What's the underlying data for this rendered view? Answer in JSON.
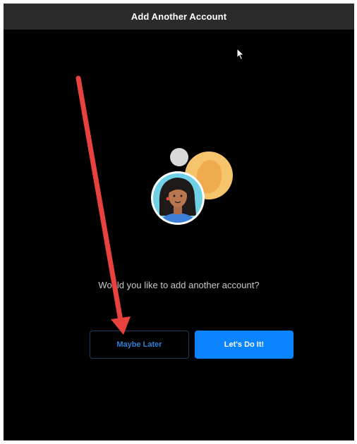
{
  "window": {
    "title": "Add Another Account"
  },
  "dialog": {
    "question": "Would you like to add another account?",
    "maybe_later_label": "Maybe Later",
    "lets_do_it_label": "Let's Do It!"
  },
  "colors": {
    "titlebar_bg": "#2b2b2b",
    "background": "#000000",
    "primary_button": "#0a84ff",
    "secondary_button_text": "#2f7fd6",
    "annotation_arrow": "#e8423f"
  },
  "icons": {
    "cursor": "mouse-pointer-icon",
    "illustration": "accounts-avatar-illustration"
  }
}
